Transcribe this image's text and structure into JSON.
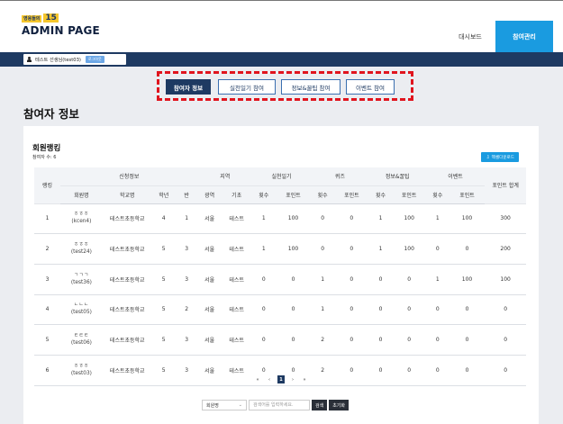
{
  "header": {
    "logo_badge_small": "영웅들의",
    "logo_badge_num": "15",
    "logo_title": "ADMIN PAGE",
    "nav": [
      "대시보드",
      "참여관리"
    ]
  },
  "userbar": {
    "user": "테스트 선생님(test03)",
    "logout": "로그아웃"
  },
  "tabs": [
    "참여자 정보",
    "실천일기 참여",
    "정보&꿀팁 참여",
    "이벤트 참여"
  ],
  "page_title": "참여자 정보",
  "card": {
    "title": "회원랭킹",
    "count_label": "참여자 수: 6",
    "excel_button": "엑셀다운로드"
  },
  "table": {
    "group_headers": [
      "랭킹",
      "신청정보",
      "지역",
      "실천일기",
      "퀴즈",
      "정보&꿀팁",
      "이벤트",
      "포인트 합계"
    ],
    "sub_headers": [
      "회원명",
      "학교명",
      "학년",
      "반",
      "광역",
      "기초",
      "횟수",
      "포인트",
      "횟수",
      "포인트",
      "횟수",
      "포인트",
      "횟수",
      "포인트"
    ],
    "rows": [
      [
        "1",
        "ㅎㅎㅎ",
        "(kcen4)",
        "테스트초등학교",
        "4",
        "1",
        "서울",
        "테스트",
        "1",
        "100",
        "0",
        "0",
        "1",
        "100",
        "1",
        "100",
        "300"
      ],
      [
        "2",
        "ㅎㅎㅎ",
        "(test24)",
        "테스트초등학교",
        "5",
        "3",
        "서울",
        "테스트",
        "1",
        "100",
        "0",
        "0",
        "1",
        "100",
        "0",
        "0",
        "200"
      ],
      [
        "3",
        "ㄱㄱㄱ",
        "(test36)",
        "테스트초등학교",
        "5",
        "3",
        "서울",
        "테스트",
        "0",
        "0",
        "1",
        "0",
        "0",
        "0",
        "1",
        "100",
        "100"
      ],
      [
        "4",
        "ㄴㄴㄴ",
        "(test05)",
        "테스트초등학교",
        "5",
        "2",
        "서울",
        "테스트",
        "0",
        "0",
        "1",
        "0",
        "0",
        "0",
        "0",
        "0",
        "0"
      ],
      [
        "5",
        "ㅌㅌㅌ",
        "(test06)",
        "테스트초등학교",
        "5",
        "3",
        "서울",
        "테스트",
        "0",
        "0",
        "2",
        "0",
        "0",
        "0",
        "0",
        "0",
        "0"
      ],
      [
        "6",
        "ㅎㅎㅎ",
        "(test03)",
        "테스트초등학교",
        "5",
        "3",
        "서울",
        "테스트",
        "0",
        "0",
        "2",
        "0",
        "0",
        "0",
        "0",
        "0",
        "0"
      ]
    ]
  },
  "pagination": {
    "first": "«",
    "prev": "‹",
    "current": "1",
    "next": "›",
    "last": "»"
  },
  "search": {
    "select_value": "회원명",
    "chevron": "⌄",
    "placeholder": "검색어를 입력하세요.",
    "search_button": "검색",
    "reset_button": "초기화"
  },
  "colors": {
    "navy": "#1e3a62",
    "accent_blue": "#1a9be0",
    "highlight_red": "#e0141e"
  }
}
